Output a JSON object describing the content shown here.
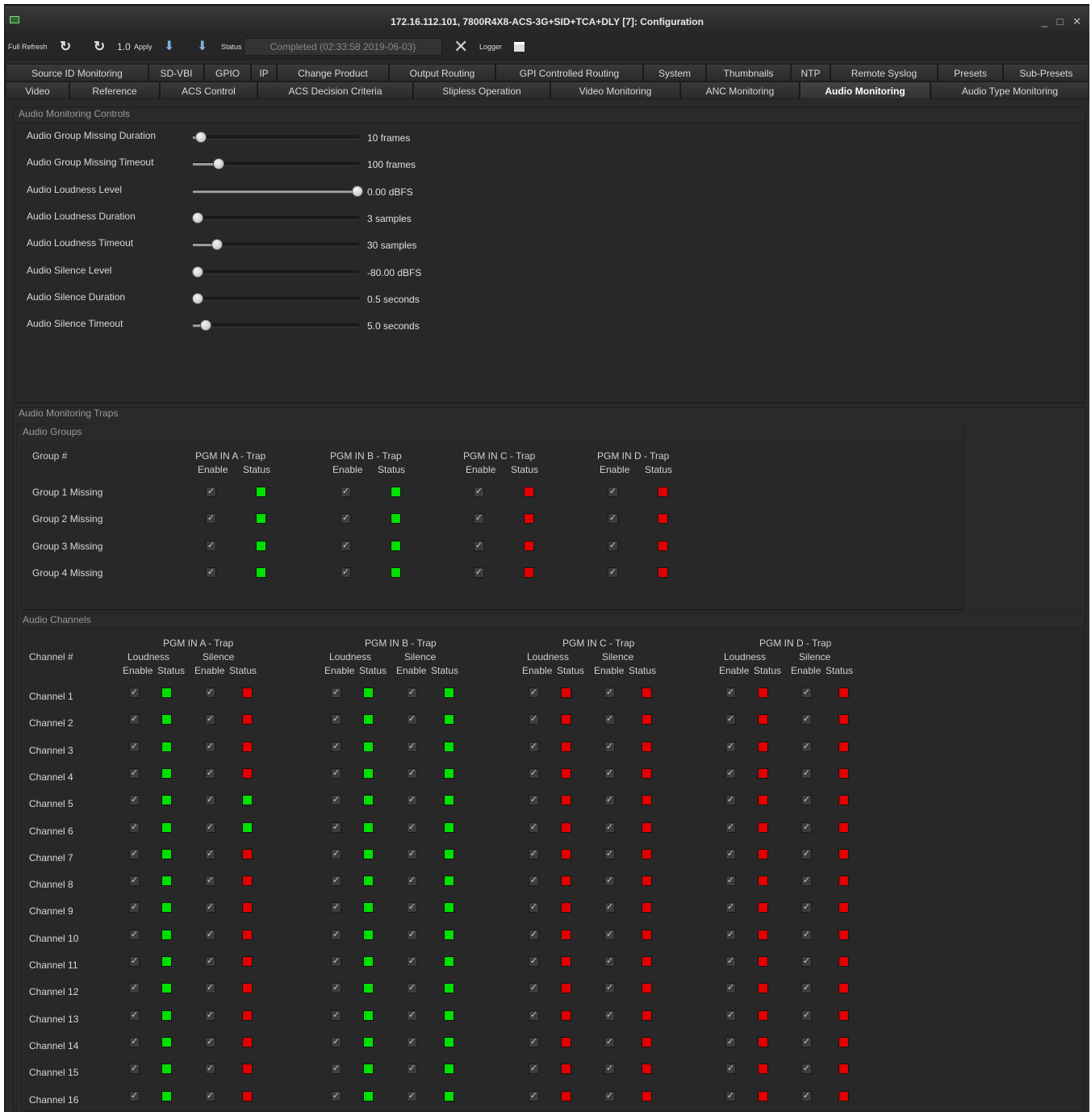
{
  "window": {
    "title": "172.16.112.101, 7800R4X8-ACS-3G+SID+TCA+DLY  [7]: Configuration",
    "controls": "_ □ ✕"
  },
  "toolbar": {
    "full_refresh": "Full Refresh",
    "version": "1.0",
    "apply": "Apply",
    "status_label": "Status",
    "status_value": "Completed  (02:33:58 2019-06-03)",
    "logger": "Logger"
  },
  "tabs_row1": [
    "Source ID Monitoring",
    "SD-VBI",
    "GPIO",
    "IP",
    "Change Product",
    "Output Routing",
    "GPI Controlled Routing",
    "System",
    "Thumbnails",
    "NTP",
    "Remote Syslog",
    "Presets",
    "Sub-Presets"
  ],
  "tabs_row2": [
    "Video",
    "Reference",
    "ACS Control",
    "ACS Decision Criteria",
    "Slipless Operation",
    "Video Monitoring",
    "ANC Monitoring",
    "Audio Monitoring",
    "Audio Type Monitoring"
  ],
  "active_tab": "Audio Monitoring",
  "controls": {
    "title": "Audio Monitoring Controls",
    "sliders": [
      {
        "label": "Audio Group Missing Duration",
        "value": "10 frames",
        "level": 0.02
      },
      {
        "label": "Audio Group Missing Timeout",
        "value": "100 frames",
        "level": 0.13
      },
      {
        "label": "Audio Loudness Level",
        "value": "0.00 dBFS",
        "level": 1.0
      },
      {
        "label": "Audio Loudness Duration",
        "value": "3 samples",
        "level": 0.0
      },
      {
        "label": "Audio Loudness Timeout",
        "value": "30 samples",
        "level": 0.12
      },
      {
        "label": "Audio Silence Level",
        "value": "-80.00 dBFS",
        "level": 0.0
      },
      {
        "label": "Audio Silence Duration",
        "value": "0.5 seconds",
        "level": 0.0
      },
      {
        "label": "Audio Silence Timeout",
        "value": "5.0 seconds",
        "level": 0.05
      }
    ]
  },
  "traps": {
    "title": "Audio Monitoring Traps",
    "groups": {
      "title": "Audio Groups",
      "row_header": "Group #",
      "columns": [
        "PGM IN A - Trap",
        "PGM IN B - Trap",
        "PGM IN C - Trap",
        "PGM IN D - Trap"
      ],
      "enable": "Enable",
      "status": "Status",
      "rows": [
        {
          "label": "Group 1 Missing",
          "status": [
            "green",
            "green",
            "red",
            "red"
          ]
        },
        {
          "label": "Group 2 Missing",
          "status": [
            "green",
            "green",
            "red",
            "red"
          ]
        },
        {
          "label": "Group 3 Missing",
          "status": [
            "green",
            "green",
            "red",
            "red"
          ]
        },
        {
          "label": "Group 4 Missing",
          "status": [
            "green",
            "green",
            "red",
            "red"
          ]
        }
      ]
    },
    "channels": {
      "title": "Audio Channels",
      "row_header": "Channel #",
      "columns": [
        "PGM IN A - Trap",
        "PGM IN B - Trap",
        "PGM IN C - Trap",
        "PGM IN D - Trap"
      ],
      "loudness": "Loudness",
      "silence": "Silence",
      "enable": "Enable",
      "status": "Status",
      "rows": [
        {
          "label": "Channel 1",
          "status": [
            "green",
            "red",
            "green",
            "green",
            "red",
            "red",
            "red",
            "red"
          ]
        },
        {
          "label": "Channel 2",
          "status": [
            "green",
            "red",
            "green",
            "green",
            "red",
            "red",
            "red",
            "red"
          ]
        },
        {
          "label": "Channel 3",
          "status": [
            "green",
            "red",
            "green",
            "green",
            "red",
            "red",
            "red",
            "red"
          ]
        },
        {
          "label": "Channel 4",
          "status": [
            "green",
            "red",
            "green",
            "green",
            "red",
            "red",
            "red",
            "red"
          ]
        },
        {
          "label": "Channel 5",
          "status": [
            "green",
            "green",
            "green",
            "green",
            "red",
            "red",
            "red",
            "red"
          ]
        },
        {
          "label": "Channel 6",
          "status": [
            "green",
            "green",
            "green",
            "green",
            "red",
            "red",
            "red",
            "red"
          ]
        },
        {
          "label": "Channel 7",
          "status": [
            "green",
            "red",
            "green",
            "green",
            "red",
            "red",
            "red",
            "red"
          ]
        },
        {
          "label": "Channel 8",
          "status": [
            "green",
            "red",
            "green",
            "green",
            "red",
            "red",
            "red",
            "red"
          ]
        },
        {
          "label": "Channel 9",
          "status": [
            "green",
            "red",
            "green",
            "green",
            "red",
            "red",
            "red",
            "red"
          ]
        },
        {
          "label": "Channel 10",
          "status": [
            "green",
            "red",
            "green",
            "green",
            "red",
            "red",
            "red",
            "red"
          ]
        },
        {
          "label": "Channel 11",
          "status": [
            "green",
            "red",
            "green",
            "green",
            "red",
            "red",
            "red",
            "red"
          ]
        },
        {
          "label": "Channel 12",
          "status": [
            "green",
            "red",
            "green",
            "green",
            "red",
            "red",
            "red",
            "red"
          ]
        },
        {
          "label": "Channel 13",
          "status": [
            "green",
            "red",
            "green",
            "green",
            "red",
            "red",
            "red",
            "red"
          ]
        },
        {
          "label": "Channel 14",
          "status": [
            "green",
            "red",
            "green",
            "green",
            "red",
            "red",
            "red",
            "red"
          ]
        },
        {
          "label": "Channel 15",
          "status": [
            "green",
            "red",
            "green",
            "green",
            "red",
            "red",
            "red",
            "red"
          ]
        },
        {
          "label": "Channel 16",
          "status": [
            "green",
            "red",
            "green",
            "green",
            "red",
            "red",
            "red",
            "red"
          ]
        }
      ]
    }
  },
  "colors": {
    "green": "#00e000",
    "red": "#e00000",
    "background": "#2a2a2a"
  },
  "icons": {
    "check": "✓",
    "close": "✕",
    "refresh": "↻"
  }
}
